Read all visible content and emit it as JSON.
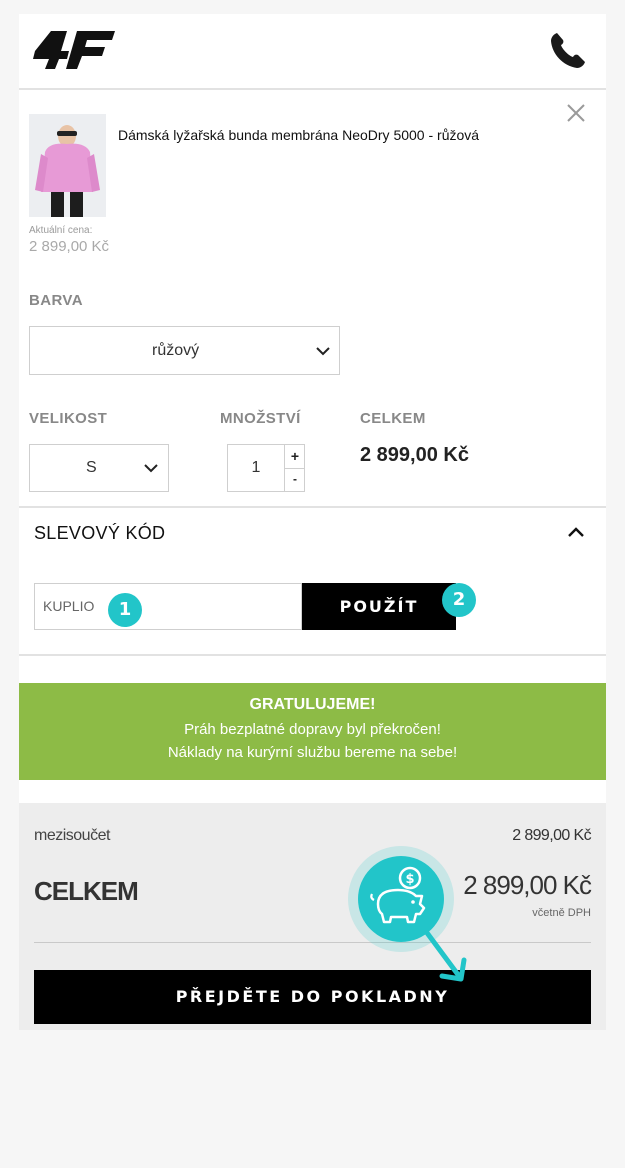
{
  "header": {
    "logo_text": "4F",
    "phone_icon": "phone-icon"
  },
  "product": {
    "title": "Dámská lyžařská bunda membrána NeoDry 5000 - růžová",
    "price_label": "Aktuální cena:",
    "price_value": "2 899,00 Kč",
    "close_icon": "close-icon"
  },
  "color": {
    "label": "BARVA",
    "selected": "růžový"
  },
  "size": {
    "label": "VELIKOST",
    "selected": "S"
  },
  "quantity": {
    "label": "MNOŽSTVÍ",
    "value": "1",
    "plus": "+",
    "minus": "-"
  },
  "total": {
    "label": "CELKEM",
    "value": "2 899,00 Kč"
  },
  "discount": {
    "title": "SLEVOVÝ KÓD",
    "code_value": "KUPLIO",
    "apply_label": "POUŽÍT",
    "badge1": "1",
    "badge2": "2"
  },
  "promo": {
    "title": "GRATULUJEME!",
    "line1": "Práh bezplatné dopravy byl překročen!",
    "line2": "Náklady na kurýrní službu bereme na sebe!",
    "color": "#8dbb46"
  },
  "summary": {
    "subtotal_label": "mezisoučet",
    "subtotal_value": "2 899,00 Kč",
    "total_label": "CELKEM",
    "total_value": "2 899,00 Kč",
    "vat_note": "včetně DPH",
    "checkout_label": "PŘEJDĚTE DO POKLADNY"
  },
  "colors": {
    "accent": "#22c5c9",
    "button": "#000000"
  }
}
